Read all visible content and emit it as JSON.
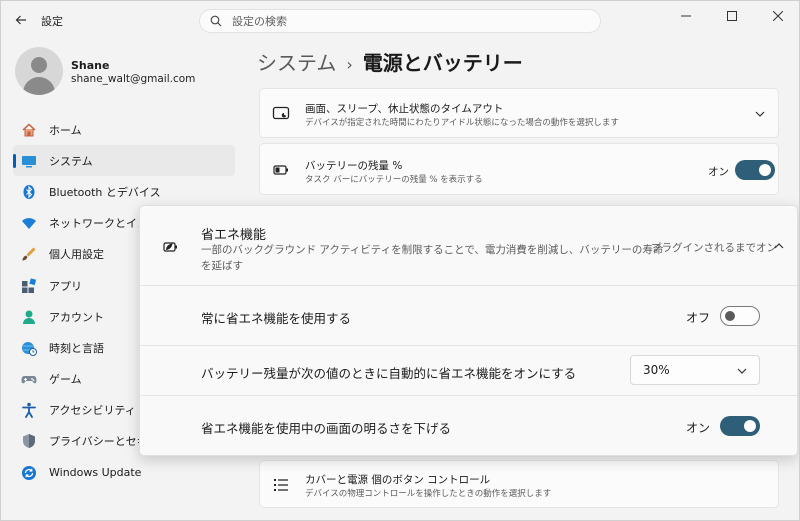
{
  "window": {
    "app_title": "設定",
    "back_icon": "back-arrow-icon",
    "search_placeholder": "設定の検索",
    "controls": [
      "minimize-icon",
      "maximize-icon",
      "close-icon"
    ]
  },
  "profile": {
    "name": "Shane",
    "email": "shane_walt@gmail.com"
  },
  "nav": [
    {
      "label": "ホーム",
      "icon": "home-icon"
    },
    {
      "label": "システム",
      "icon": "monitor-icon",
      "active": true
    },
    {
      "label": "Bluetooth とデバイス",
      "icon": "bluetooth-icon"
    },
    {
      "label": "ネットワークとインター",
      "icon": "wifi-icon"
    },
    {
      "label": "個人用設定",
      "icon": "brush-icon"
    },
    {
      "label": "アプリ",
      "icon": "apps-icon"
    },
    {
      "label": "アカウント",
      "icon": "account-icon"
    },
    {
      "label": "時刻と言語",
      "icon": "globe-clock-icon"
    },
    {
      "label": "ゲーム",
      "icon": "gamepad-icon"
    },
    {
      "label": "アクセシビリティ",
      "icon": "accessibility-icon"
    },
    {
      "label": "プライバシーとセキュリ",
      "icon": "shield-icon"
    },
    {
      "label": "Windows Update",
      "icon": "update-icon"
    }
  ],
  "breadcrumb": {
    "parent": "システム",
    "separator": "›",
    "current": "電源とバッテリー"
  },
  "cards": {
    "sleep": {
      "title": "画面、スリープ、休止状態のタイムアウト",
      "subtitle": "デバイスが指定された時間にわたりアイドル状態になった場合の動作を選択します"
    },
    "battery_percent": {
      "title": "バッテリーの残量 %",
      "subtitle": "タスク バーにバッテリーの残量 % を表示する",
      "state_label": "オン",
      "on": true
    },
    "lid": {
      "title": "カバーと電源 個のボタン コントロール",
      "subtitle": "デバイスの物理コントロールを操作したときの動作を選択します"
    }
  },
  "energy_saver": {
    "title": "省エネ機能",
    "description_line1": "一部のバックグラウンド アクティビティを制限することで、電力消費を削減し、バッテリーの寿命",
    "description_line2": "を延ばす",
    "status": "プラグインされるまでオン",
    "rows": {
      "always": {
        "label": "常に省エネ機能を使用する",
        "state_label": "オフ",
        "on": false
      },
      "threshold": {
        "label": "バッテリー残量が次の値のときに自動的に省エネ機能をオンにする",
        "value": "30%"
      },
      "brightness": {
        "label": "省エネ機能を使用中の画面の明るさを下げる",
        "state_label": "オン",
        "on": true
      }
    }
  },
  "colors": {
    "accent": "#005fb8",
    "toggle_on": "#2e5e78",
    "background": "#f3f3f3",
    "card": "#fbfbfb"
  }
}
